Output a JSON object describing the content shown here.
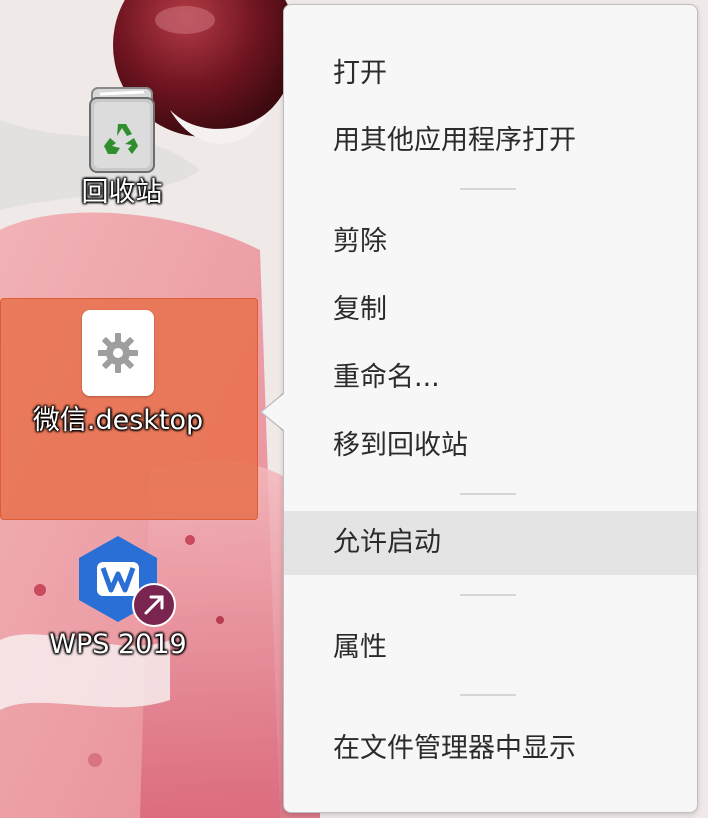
{
  "desktop": {
    "icons": [
      {
        "label": "回收站",
        "icon": "recycle-bin-icon"
      },
      {
        "label": "微信.desktop",
        "icon": "gear-icon",
        "selected": true
      },
      {
        "label": "WPS 2019",
        "icon": "wps-icon",
        "badge": "shortcut-arrow-icon"
      }
    ],
    "selection_color": "#e86e48"
  },
  "context_menu": {
    "items": [
      {
        "label": "打开"
      },
      {
        "label": "用其他应用程序打开"
      },
      {
        "separator": true
      },
      {
        "label": "剪除"
      },
      {
        "label": "复制"
      },
      {
        "label": "重命名..."
      },
      {
        "label": "移到回收站"
      },
      {
        "separator": true
      },
      {
        "label": "允许启动",
        "highlighted": true
      },
      {
        "separator": true
      },
      {
        "label": "属性"
      },
      {
        "separator": true
      },
      {
        "label": "在文件管理器中显示"
      }
    ]
  }
}
